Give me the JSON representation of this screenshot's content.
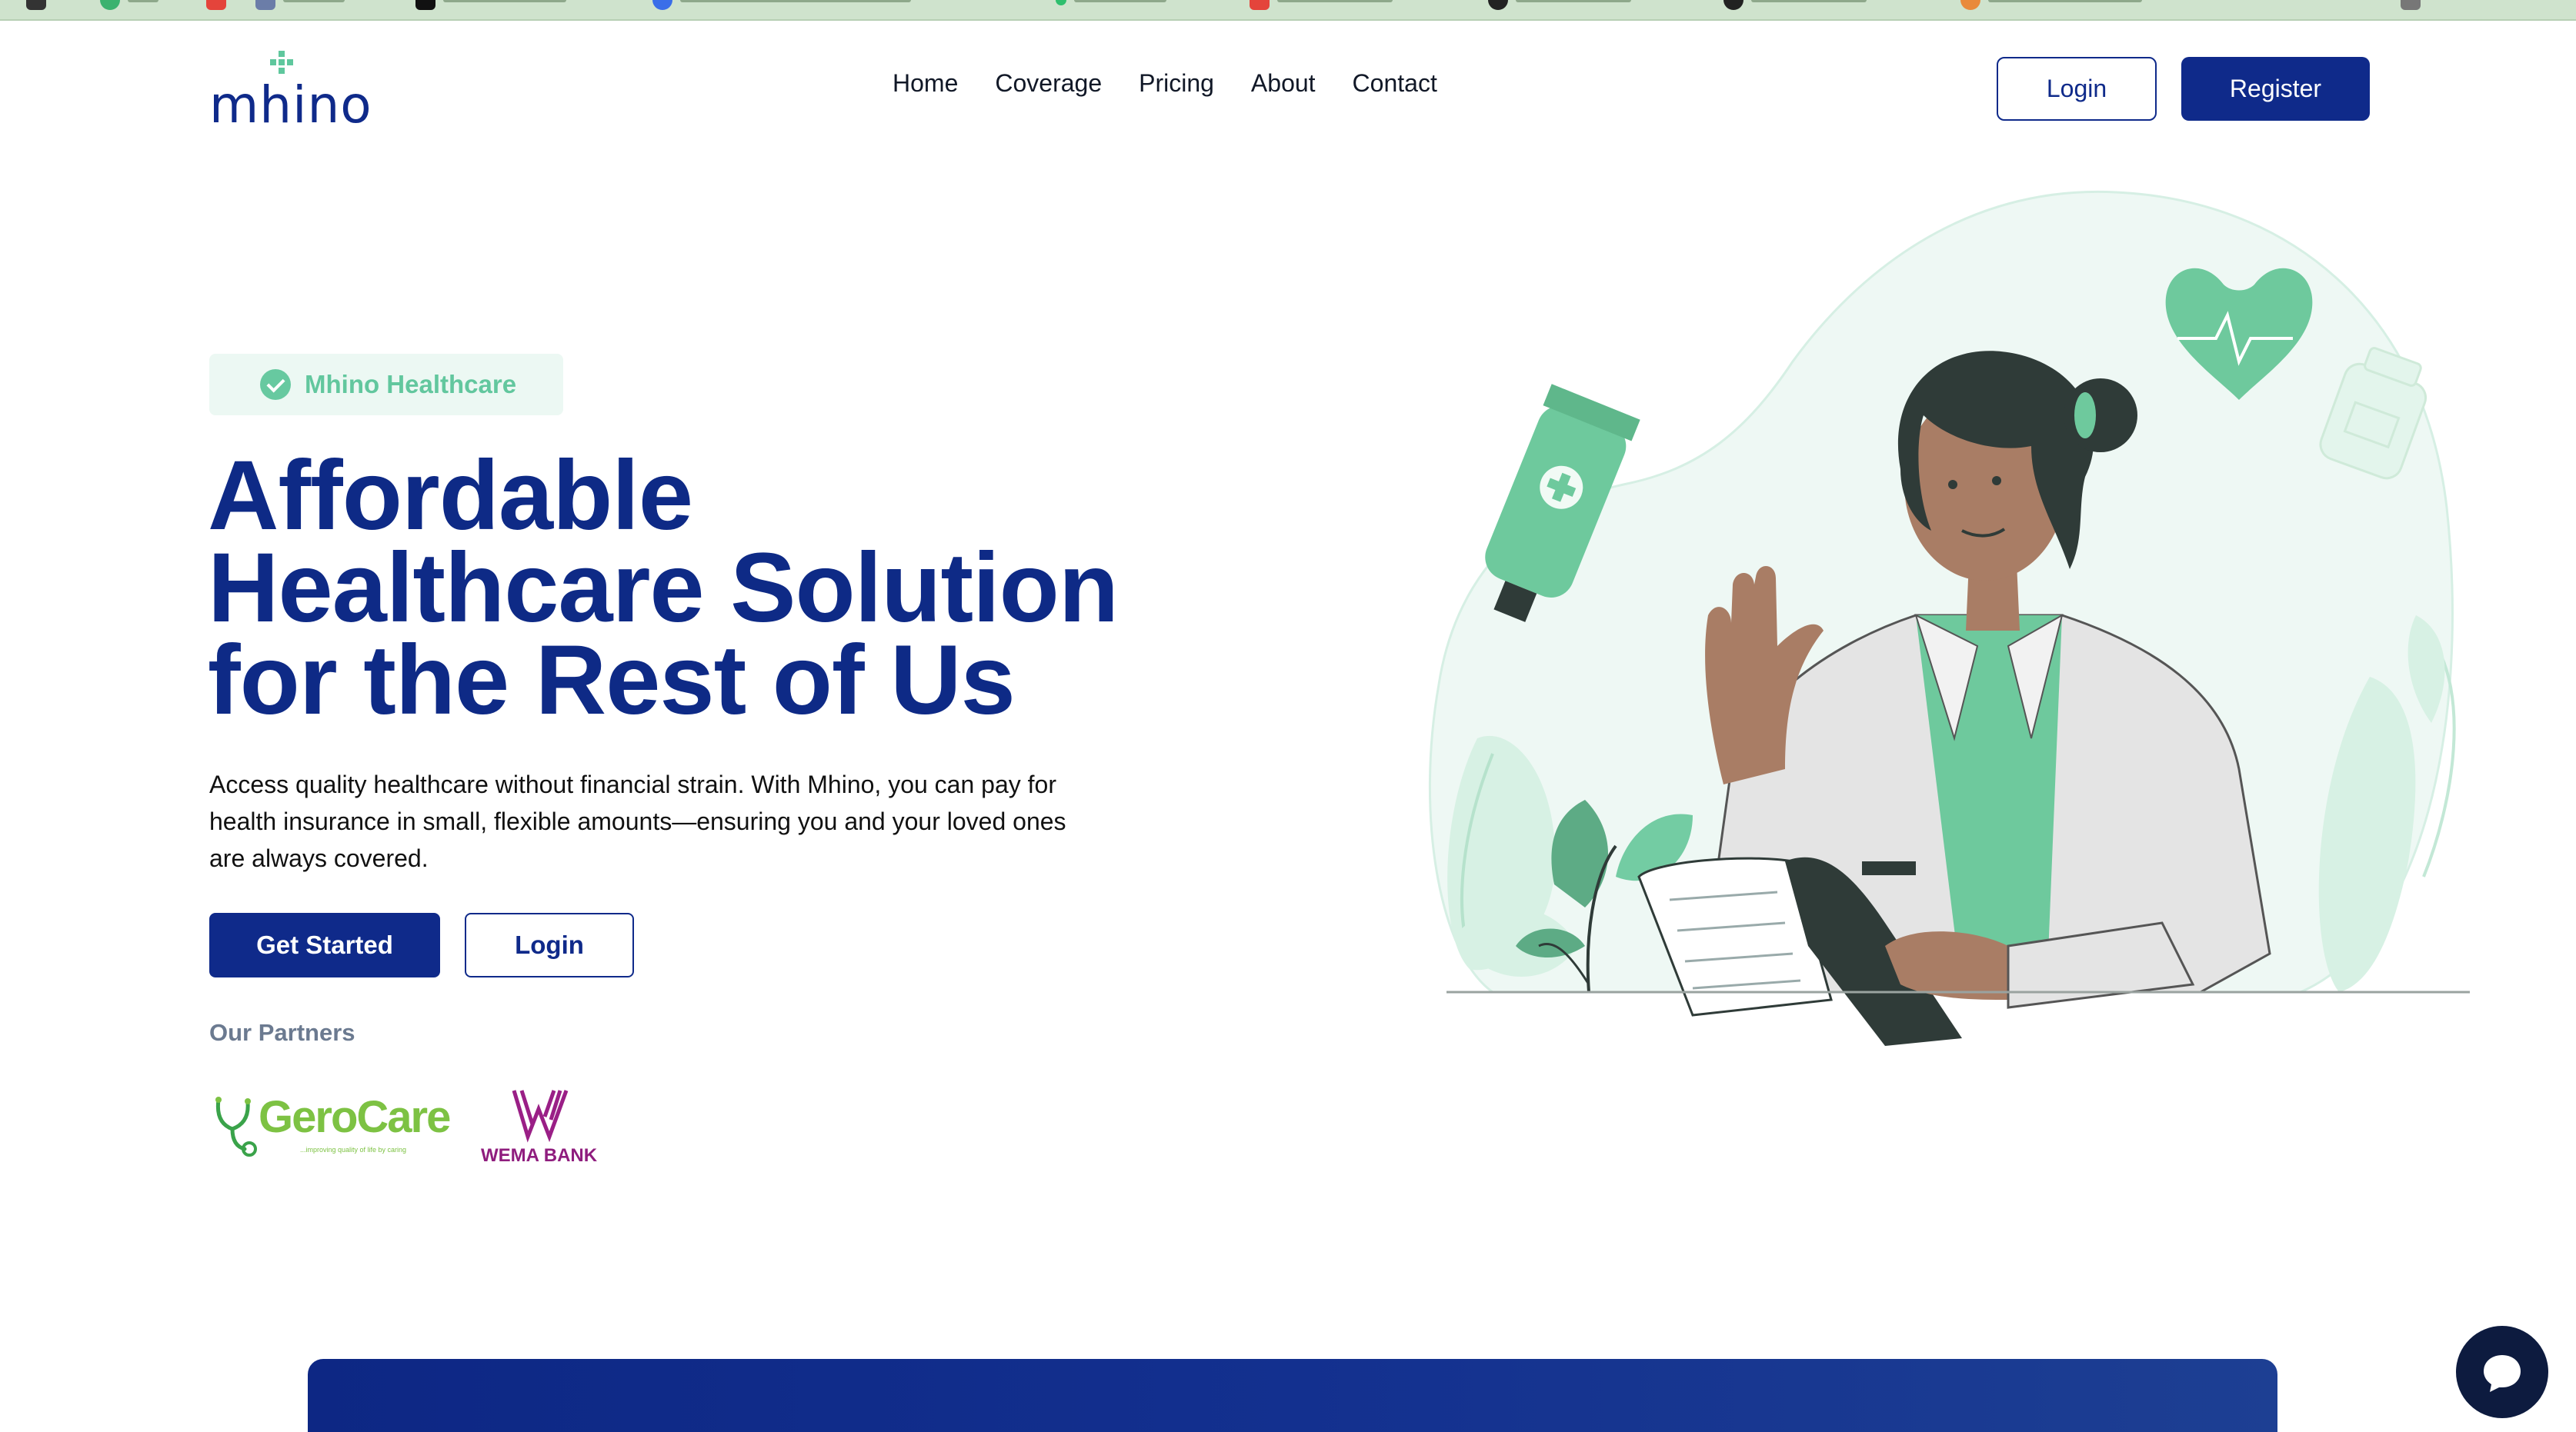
{
  "brand": {
    "logo_text": "mhino",
    "primary_color": "#0f2a8a",
    "accent_color": "#67c9a0"
  },
  "nav": {
    "items": [
      "Home",
      "Coverage",
      "Pricing",
      "About",
      "Contact"
    ],
    "login_label": "Login",
    "register_label": "Register"
  },
  "hero": {
    "badge_label": "Mhino Healthcare",
    "title_lines": [
      "Affordable",
      "Healthcare Solution",
      "for the Rest of Us"
    ],
    "description": "Access quality healthcare without financial strain. With Mhino, you can pay for health insurance in small, flexible amounts—ensuring you and your loved ones are always covered.",
    "get_started_label": "Get Started",
    "login_label": "Login"
  },
  "partners": {
    "title": "Our Partners",
    "items": [
      {
        "name": "GeroCare",
        "tagline": "...improving quality of life by caring"
      },
      {
        "name": "WEMA BANK"
      }
    ]
  },
  "illustration": {
    "icon": "doctor-waving-illustration"
  },
  "chat": {
    "icon": "chat-bubble-icon"
  }
}
